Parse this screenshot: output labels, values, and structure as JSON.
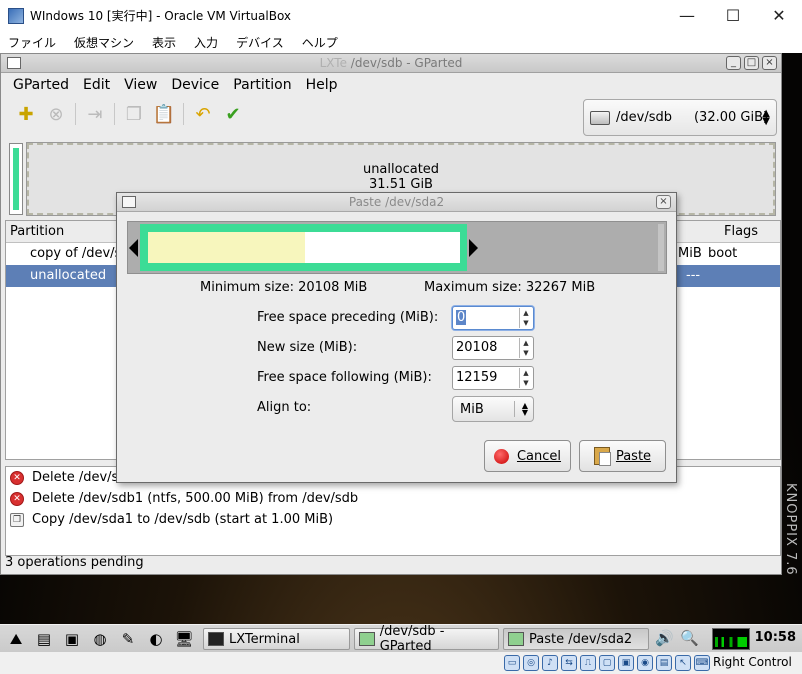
{
  "host": {
    "title": "WIndows 10 [実行中] - Oracle VM VirtualBox",
    "menu": [
      "ファイル",
      "仮想マシン",
      "表示",
      "入力",
      "デバイス",
      "ヘルプ"
    ],
    "minimize": "—",
    "maximize": "☐",
    "close": "✕",
    "right_control": "Right Control"
  },
  "gparted": {
    "title": "/dev/sdb - GParted",
    "title_prefix": "LXTe",
    "menu": [
      "GParted",
      "Edit",
      "View",
      "Device",
      "Partition",
      "Help"
    ],
    "device": "/dev/sdb",
    "device_size": "(32.00 GiB)",
    "visual": {
      "label": "unallocated",
      "size": "31.51 GiB"
    },
    "table": {
      "col_partition": "Partition",
      "col_flags": "Flags",
      "rows": [
        {
          "name": "copy of /dev/s",
          "size_tail": "MiB",
          "flags": "boot"
        },
        {
          "name": "unallocated",
          "size_tail": "",
          "flags": "---"
        }
      ]
    },
    "operations": [
      "Delete /dev/s",
      "Delete /dev/sdb1 (ntfs, 500.00 MiB) from /dev/sdb",
      "Copy /dev/sda1 to /dev/sdb (start at 1.00 MiB)"
    ],
    "status": "3 operations pending"
  },
  "dialog": {
    "title": "Paste /dev/sda2",
    "min_size": "Minimum size: 20108 MiB",
    "max_size": "Maximum size: 32267 MiB",
    "fields": {
      "free_preceding": {
        "label": "Free space preceding (MiB):",
        "value": "0"
      },
      "new_size": {
        "label": "New size (MiB):",
        "value": "20108"
      },
      "free_following": {
        "label": "Free space following (MiB):",
        "value": "12159"
      },
      "align": {
        "label": "Align to:",
        "value": "MiB"
      }
    },
    "cancel": "Cancel",
    "paste": "Paste"
  },
  "desktop": {
    "watermark": "KNOPPIX 7.6"
  },
  "taskbar": {
    "tasks": [
      "LXTerminal",
      "/dev/sdb - GParted",
      "Paste /dev/sda2"
    ],
    "clock": "10:58"
  },
  "colors": {
    "partition_border": "#3cdc96",
    "used_space": "#f7f6bd",
    "selection": "#5d7fb6"
  }
}
